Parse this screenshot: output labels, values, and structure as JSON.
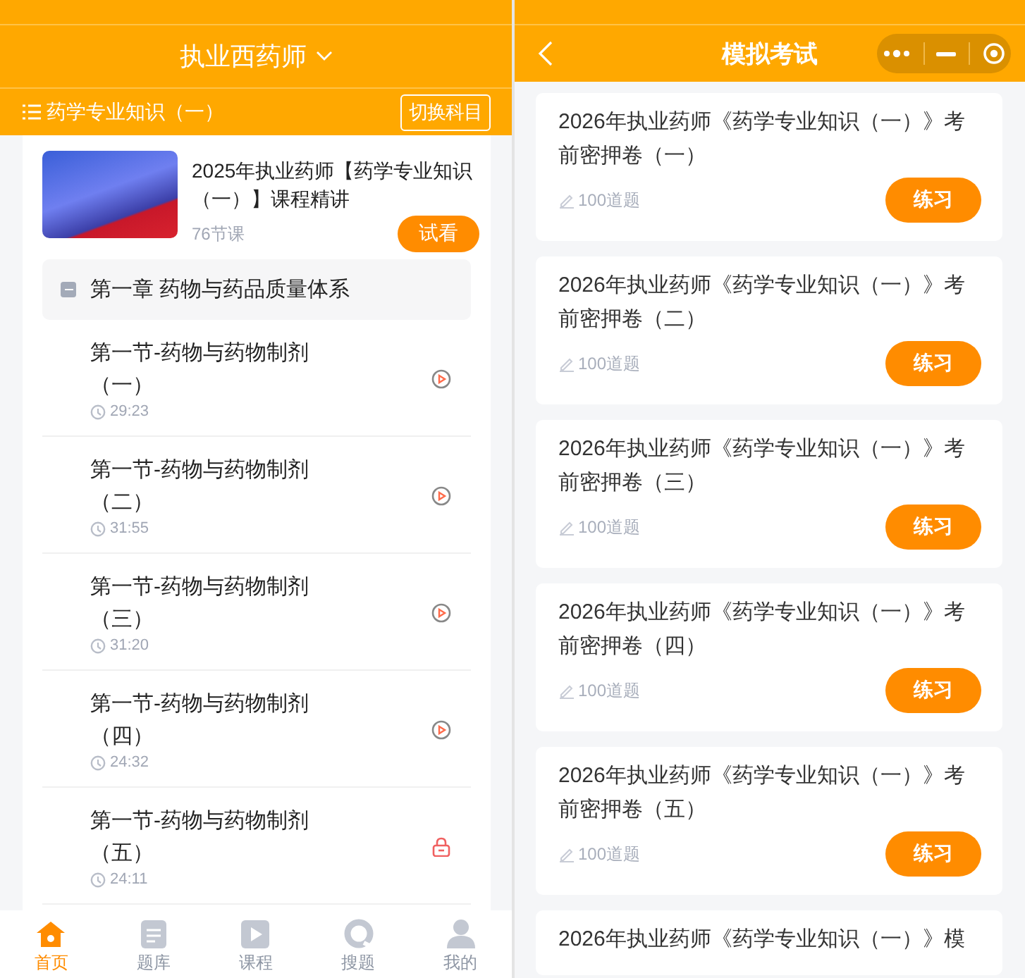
{
  "left": {
    "title": "执业西药师",
    "subject": "药学专业知识（一）",
    "switch_button": "切换科目",
    "course": {
      "title": "2025年执业药师【药学专业知识（一）】课程精讲",
      "lessons_count": "76节课",
      "trial_button": "试看"
    },
    "chapter": {
      "title": "第一章 药物与药品质量体系",
      "expanded": true,
      "lessons": [
        {
          "title": "第一节-药物与药物制剂（一）",
          "duration": "29:23",
          "kind": "video"
        },
        {
          "title": "第一节-药物与药物制剂（二）",
          "duration": "31:55",
          "kind": "video"
        },
        {
          "title": "第一节-药物与药物制剂（三）",
          "duration": "31:20",
          "kind": "video"
        },
        {
          "title": "第一节-药物与药物制剂（四）",
          "duration": "24:32",
          "kind": "video"
        },
        {
          "title": "第一节-药物与药物制剂（五）",
          "duration": "24:11",
          "kind": "locked"
        }
      ]
    },
    "tab_bar": [
      {
        "label": "首页",
        "kind": "home",
        "selected": true
      },
      {
        "label": "题库",
        "kind": "document",
        "selected": false
      },
      {
        "label": "课程",
        "kind": "play",
        "selected": false
      },
      {
        "label": "搜题",
        "kind": "search",
        "selected": false
      },
      {
        "label": "我的",
        "kind": "person",
        "selected": false
      }
    ]
  },
  "right": {
    "title": "模拟考试",
    "exams": [
      {
        "title": "2026年执业药师《药学专业知识（一）》考前密押卷（一）",
        "count": "100道题",
        "button": "练习"
      },
      {
        "title": "2026年执业药师《药学专业知识（一）》考前密押卷（二）",
        "count": "100道题",
        "button": "练习"
      },
      {
        "title": "2026年执业药师《药学专业知识（一）》考前密押卷（三）",
        "count": "100道题",
        "button": "练习"
      },
      {
        "title": "2026年执业药师《药学专业知识（一）》考前密押卷（四）",
        "count": "100道题",
        "button": "练习"
      },
      {
        "title": "2026年执业药师《药学专业知识（一）》考前密押卷（五）",
        "count": "100道题",
        "button": "练习"
      },
      {
        "title": "2026年执业药师《药学专业知识（一）》模"
      }
    ]
  }
}
